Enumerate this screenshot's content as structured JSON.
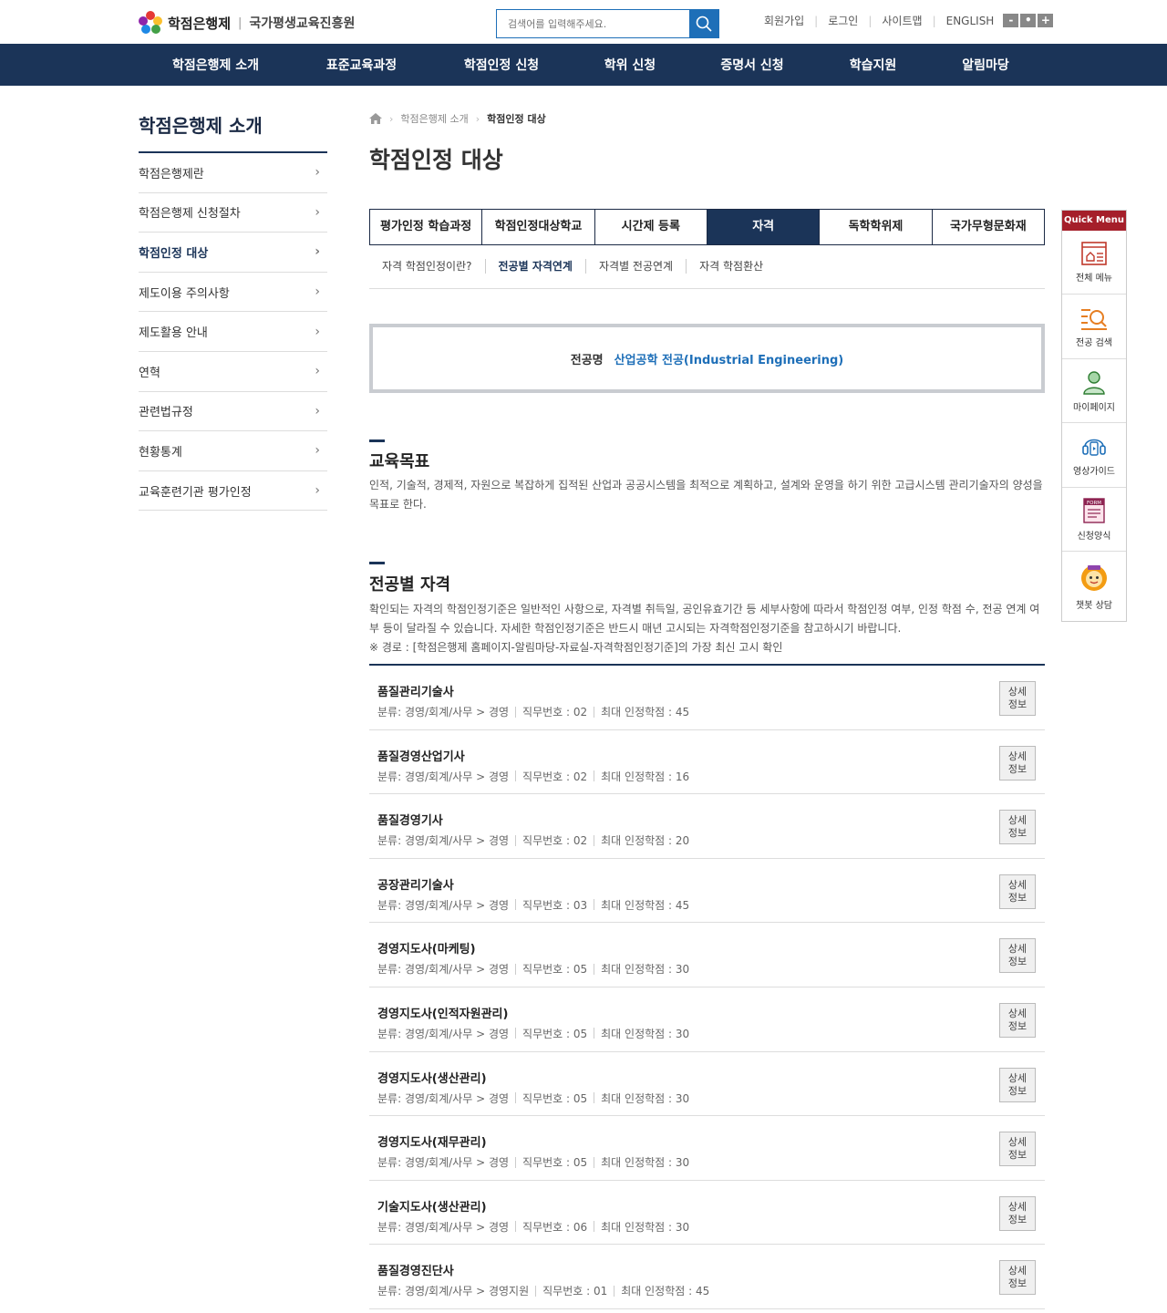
{
  "header": {
    "logo_text": "학점은행제",
    "logo_divider": "|",
    "logo_sub": "국가평생교육진흥원",
    "search_placeholder": "검색어를 입력해주세요.",
    "util_links": [
      "회원가입",
      "로그인",
      "사이트맵",
      "ENGLISH"
    ],
    "zoom": [
      "-",
      "•",
      "+"
    ]
  },
  "gnb": [
    "학점은행제 소개",
    "표준교육과정",
    "학점인정 신청",
    "학위 신청",
    "증명서 신청",
    "학습지원",
    "알림마당"
  ],
  "lnb": {
    "title": "학점은행제 소개",
    "items": [
      {
        "label": "학점은행제란",
        "active": false
      },
      {
        "label": "학점은행제 신청절차",
        "active": false
      },
      {
        "label": "학점인정 대상",
        "active": true
      },
      {
        "label": "제도이용 주의사항",
        "active": false
      },
      {
        "label": "제도활용 안내",
        "active": false
      },
      {
        "label": "연혁",
        "active": false
      },
      {
        "label": "관련법규정",
        "active": false
      },
      {
        "label": "현황통계",
        "active": false
      },
      {
        "label": "교육훈련기관 평가인정",
        "active": false
      }
    ]
  },
  "breadcrumb": [
    "학점은행제 소개",
    "학점인정 대상"
  ],
  "page_title": "학점인정 대상",
  "tabs": [
    {
      "label": "평가인정 학습과정",
      "active": false
    },
    {
      "label": "학점인정대상학교",
      "active": false
    },
    {
      "label": "시간제 등록",
      "active": false
    },
    {
      "label": "자격",
      "active": true
    },
    {
      "label": "독학학위제",
      "active": false
    },
    {
      "label": "국가무형문화재",
      "active": false
    }
  ],
  "subtabs": [
    {
      "label": "자격 학점인정이란?",
      "active": false
    },
    {
      "label": "전공별 자격연계",
      "active": true
    },
    {
      "label": "자격별 전공연계",
      "active": false
    },
    {
      "label": "자격 학점환산",
      "active": false
    }
  ],
  "major": {
    "label": "전공명",
    "value": "산업공학 전공(Industrial Engineering)"
  },
  "edu_goal": {
    "title": "교육목표",
    "text": "인적, 기술적, 경제적, 자원으로 복잡하게 집적된 산업과 공공시스템을 최적으로 계획하고, 설계와 운영을 하기 위한 고급시스템 관리기술자의 양성을 목표로 한다."
  },
  "qual_section": {
    "title": "전공별 자격",
    "text": "확인되는 자격의 학점인정기준은 일반적인 사항으로, 자격별 취득일, 공인유효기간 등 세부사항에 따라서 학점인정 여부, 인정 학점 수, 전공 연계 여부 등이 달라질 수 있습니다. 자세한 학점인정기준은 반드시 매년 고시되는 자격학점인정기준을 참고하시기 바랍니다.",
    "note": "※ 경로 : [학점은행제 홈페이지-알림마당-자료실-자격학점인정기준]의 가장 최신 고시 확인",
    "button_line1": "상세",
    "button_line2": "정보",
    "items": [
      {
        "name": "품질관리기술사",
        "category": "분류: 경영/회계/사무 > 경영",
        "job": "직무번호 : 02",
        "credit": "최대 인정학점 : 45"
      },
      {
        "name": "품질경영산업기사",
        "category": "분류: 경영/회계/사무 > 경영",
        "job": "직무번호 : 02",
        "credit": "최대 인정학점 : 16"
      },
      {
        "name": "품질경영기사",
        "category": "분류: 경영/회계/사무 > 경영",
        "job": "직무번호 : 02",
        "credit": "최대 인정학점 : 20"
      },
      {
        "name": "공장관리기술사",
        "category": "분류: 경영/회계/사무 > 경영",
        "job": "직무번호 : 03",
        "credit": "최대 인정학점 : 45"
      },
      {
        "name": "경영지도사(마케팅)",
        "category": "분류: 경영/회계/사무 > 경영",
        "job": "직무번호 : 05",
        "credit": "최대 인정학점 : 30"
      },
      {
        "name": "경영지도사(인적자원관리)",
        "category": "분류: 경영/회계/사무 > 경영",
        "job": "직무번호 : 05",
        "credit": "최대 인정학점 : 30"
      },
      {
        "name": "경영지도사(생산관리)",
        "category": "분류: 경영/회계/사무 > 경영",
        "job": "직무번호 : 05",
        "credit": "최대 인정학점 : 30"
      },
      {
        "name": "경영지도사(재무관리)",
        "category": "분류: 경영/회계/사무 > 경영",
        "job": "직무번호 : 05",
        "credit": "최대 인정학점 : 30"
      },
      {
        "name": "기술지도사(생산관리)",
        "category": "분류: 경영/회계/사무 > 경영",
        "job": "직무번호 : 06",
        "credit": "최대 인정학점 : 30"
      },
      {
        "name": "품질경영진단사",
        "category": "분류: 경영/회계/사무 > 경영지원",
        "job": "직무번호 : 01",
        "credit": "최대 인정학점 : 45"
      }
    ]
  },
  "quick_menu": {
    "title": "Quick Menu",
    "items": [
      {
        "label": "전체 메뉴",
        "icon": "menu-icon"
      },
      {
        "label": "전공 검색",
        "icon": "search-list-icon"
      },
      {
        "label": "마이페이지",
        "icon": "user-icon"
      },
      {
        "label": "영상가이드",
        "icon": "headset-icon"
      },
      {
        "label": "신청양식",
        "icon": "form-icon"
      },
      {
        "label": "챗봇 상담",
        "icon": "chatbot-icon"
      }
    ]
  },
  "colors": {
    "navy": "#1b3458",
    "blue": "#1e6fb8",
    "quick_red": "#a51f2a"
  }
}
